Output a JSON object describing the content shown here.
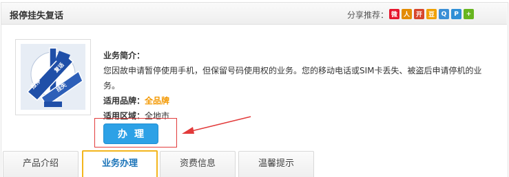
{
  "header": {
    "title": "报停挂失复话",
    "share_label": "分享推荐：",
    "share_icons": [
      {
        "name": "sina-weibo-icon",
        "glyph": "微",
        "color": "#e6162d"
      },
      {
        "name": "renren-icon",
        "glyph": "人",
        "color": "#e38b00"
      },
      {
        "name": "kaixin-icon",
        "glyph": "开",
        "color": "#d7452b"
      },
      {
        "name": "douban-icon",
        "glyph": "豆",
        "color": "#f0a000"
      },
      {
        "name": "qq-zone-icon",
        "glyph": "Q",
        "color": "#3a8fd6"
      },
      {
        "name": "pengyou-icon",
        "glyph": "P",
        "color": "#2f8fd6"
      },
      {
        "name": "more-share-icon",
        "glyph": "+",
        "color": "#67b51f"
      }
    ]
  },
  "product": {
    "thumb_words": [
      "报停",
      "复话",
      "挂失"
    ],
    "intro_label": "业务简介：",
    "intro_text": "您因故申请暂停使用手机，但保留号码使用权的业务。您的移动电话或SIM卡丢失、被盗后申请停机的业务。",
    "brand_label": "适用品牌：",
    "brand_value": "全品牌",
    "region_label": "适用区域：",
    "region_value": "全地市",
    "handle_button": "办理"
  },
  "tabs": [
    {
      "label": "产品介绍",
      "active": false
    },
    {
      "label": "业务办理",
      "active": true
    },
    {
      "label": "资费信息",
      "active": false
    },
    {
      "label": "温馨提示",
      "active": false
    }
  ],
  "colors": {
    "accent_blue": "#2da1e6",
    "brand_orange": "#f39800",
    "tab_active_border": "#f3b51c",
    "annotation_red": "#e23a3a"
  }
}
